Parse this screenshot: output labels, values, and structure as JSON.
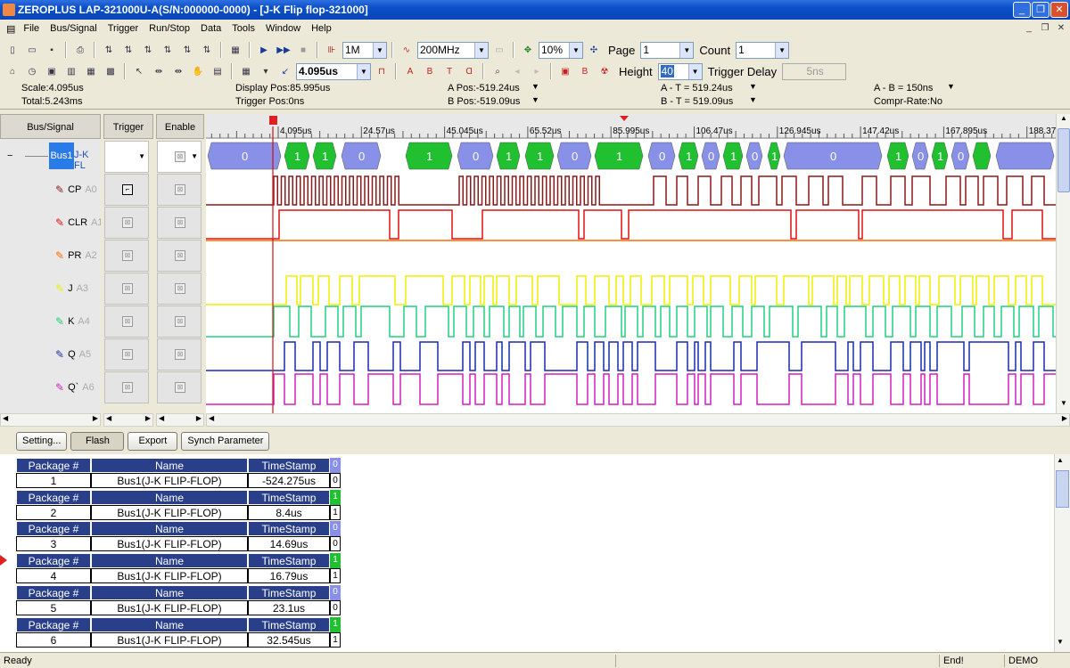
{
  "window": {
    "title": "ZEROPLUS LAP-321000U-A(S/N:000000-0000) - [J-K Flip flop-321000]"
  },
  "menu": [
    "File",
    "Bus/Signal",
    "Trigger",
    "Run/Stop",
    "Data",
    "Tools",
    "Window",
    "Help"
  ],
  "toolbar1": {
    "memory": "1M",
    "rate": "200MHz",
    "ratio": "10%",
    "page_label": "Page",
    "page": "1",
    "count_label": "Count",
    "count": "1"
  },
  "toolbar2": {
    "time": "4.095us",
    "height_label": "Height",
    "height": "40",
    "trigger_delay_label": "Trigger Delay",
    "trigger_delay": "5ns"
  },
  "info": {
    "scale": "Scale:4.095us",
    "total": "Total:5.243ms",
    "display_pos": "Display Pos:85.995us",
    "trigger_pos": "Trigger Pos:0ns",
    "a_pos": "A Pos:-519.24us",
    "b_pos": "B Pos:-519.09us",
    "a_t": "A - T = 519.24us",
    "b_t": "B - T = 519.09us",
    "a_b": "A - B = 150ns",
    "compr": "Compr-Rate:No"
  },
  "headers": {
    "bus_signal": "Bus/Signal",
    "trigger": "Trigger",
    "enable": "Enable"
  },
  "bus": {
    "name": "Bus1",
    "label": "J-K FL"
  },
  "signals": [
    {
      "name": "CP",
      "ch": "A0"
    },
    {
      "name": "CLR",
      "ch": "A1"
    },
    {
      "name": "PR",
      "ch": "A2"
    },
    {
      "name": "J",
      "ch": "A3"
    },
    {
      "name": "K",
      "ch": "A4"
    },
    {
      "name": "Q",
      "ch": "A5"
    },
    {
      "name": "Q`",
      "ch": "A6"
    }
  ],
  "ruler": [
    "4.095us",
    "24.57us",
    "45.045us",
    "65.52us",
    "85.995us",
    "106.47us",
    "126.945us",
    "147.42us",
    "167.895us",
    "188.37"
  ],
  "bus_values": [
    "0",
    "1",
    "1",
    "0",
    "1",
    "0",
    "1",
    "1",
    "0",
    "1",
    "0",
    "1",
    "0",
    "1",
    "0",
    "1",
    "0",
    "1",
    "0",
    "1",
    "0"
  ],
  "buttons": {
    "setting": "Setting...",
    "flash": "Flash",
    "export": "Export",
    "synch": "Synch Parameter"
  },
  "packages": {
    "col_headers": [
      "Package #",
      "Name",
      "TimeStamp"
    ],
    "rows": [
      {
        "num": "1",
        "name": "Bus1(J-K FLIP-FLOP)",
        "ts": "-524.275us",
        "bit": "0"
      },
      {
        "num": "2",
        "name": "Bus1(J-K FLIP-FLOP)",
        "ts": "8.4us",
        "bit": "1"
      },
      {
        "num": "3",
        "name": "Bus1(J-K FLIP-FLOP)",
        "ts": "14.69us",
        "bit": "0"
      },
      {
        "num": "4",
        "name": "Bus1(J-K FLIP-FLOP)",
        "ts": "16.79us",
        "bit": "1"
      },
      {
        "num": "5",
        "name": "Bus1(J-K FLIP-FLOP)",
        "ts": "23.1us",
        "bit": "0"
      },
      {
        "num": "6",
        "name": "Bus1(J-K FLIP-FLOP)",
        "ts": "32.545us",
        "bit": "1"
      }
    ]
  },
  "status": {
    "left": "Ready",
    "end": "End!",
    "mode": "DEMO"
  },
  "colors": {
    "cp": "#8b1a1a",
    "clr": "#e01010",
    "pr": "#ff6a00",
    "j": "#f0f000",
    "k": "#20d080",
    "q": "#1a2ab0",
    "qbar": "#d020c0",
    "bus0": "#8890e8",
    "bus1": "#20c030",
    "cursor": "#d01010"
  }
}
